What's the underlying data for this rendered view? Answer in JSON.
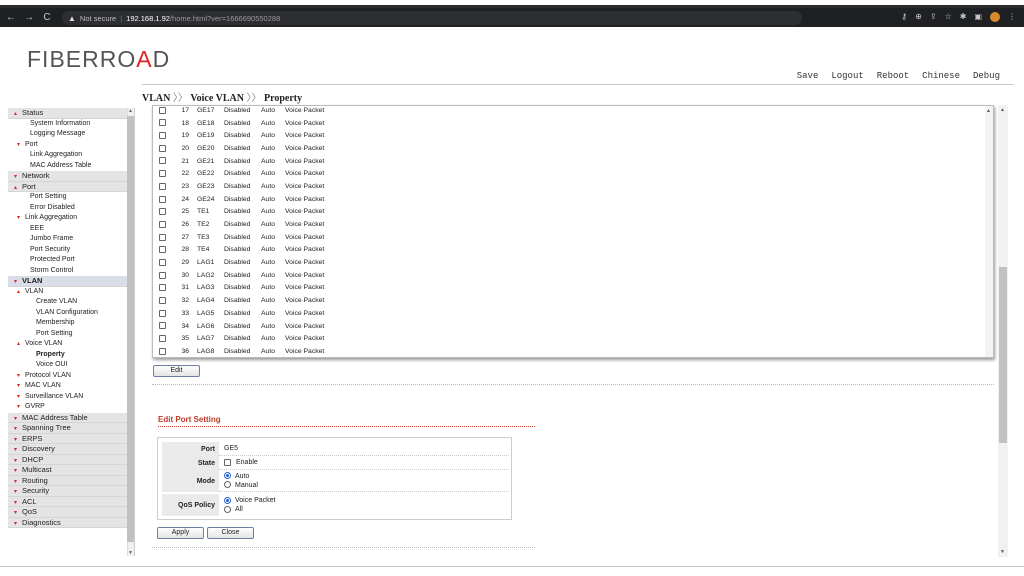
{
  "browser": {
    "security_label": "Not secure",
    "url_host": "192.168.1.92",
    "url_path": "/home.html?ver=1666690550288"
  },
  "header": {
    "logo_main": "FIBERRO",
    "logo_accent": "A",
    "logo_tail": "D",
    "menu": [
      "Save",
      "Logout",
      "Reboot",
      "Chinese",
      "Debug"
    ]
  },
  "breadcrumb": [
    "VLAN",
    "Voice VLAN",
    "Property"
  ],
  "breadcrumb_sep": "〉〉",
  "sidebar": [
    {
      "label": "Status",
      "level": "top",
      "caret": "up"
    },
    {
      "label": "System Information",
      "level": "l2"
    },
    {
      "label": "Logging Message",
      "level": "l2"
    },
    {
      "label": "Port",
      "level": "l2g",
      "caret": "dn"
    },
    {
      "label": "Link Aggregation",
      "level": "l2"
    },
    {
      "label": "MAC Address Table",
      "level": "l2"
    },
    {
      "label": "Network",
      "level": "top",
      "caret": "dn"
    },
    {
      "label": "Port",
      "level": "top",
      "caret": "up"
    },
    {
      "label": "Port Setting",
      "level": "l2"
    },
    {
      "label": "Error Disabled",
      "level": "l2"
    },
    {
      "label": "Link Aggregation",
      "level": "l2g",
      "caret": "dn"
    },
    {
      "label": "EEE",
      "level": "l2"
    },
    {
      "label": "Jumbo Frame",
      "level": "l2"
    },
    {
      "label": "Port Security",
      "level": "l2"
    },
    {
      "label": "Protected Port",
      "level": "l2"
    },
    {
      "label": "Storm Control",
      "level": "l2"
    },
    {
      "label": "VLAN",
      "level": "top-vlan",
      "caret": "dn"
    },
    {
      "label": "VLAN",
      "level": "l2g",
      "caret": "up"
    },
    {
      "label": "Create VLAN",
      "level": "l3"
    },
    {
      "label": "VLAN Configuration",
      "level": "l3"
    },
    {
      "label": "Membership",
      "level": "l3"
    },
    {
      "label": "Port Setting",
      "level": "l3"
    },
    {
      "label": "Voice VLAN",
      "level": "l2g",
      "caret": "up"
    },
    {
      "label": "Property",
      "level": "l3",
      "active": true
    },
    {
      "label": "Voice OUI",
      "level": "l3"
    },
    {
      "label": "Protocol VLAN",
      "level": "l2g",
      "caret": "dn"
    },
    {
      "label": "MAC VLAN",
      "level": "l2g",
      "caret": "dn"
    },
    {
      "label": "Surveillance VLAN",
      "level": "l2g",
      "caret": "dn"
    },
    {
      "label": "GVRP",
      "level": "l2g",
      "caret": "dn"
    },
    {
      "label": "MAC Address Table",
      "level": "top",
      "caret": "dn"
    },
    {
      "label": "Spanning Tree",
      "level": "top",
      "caret": "dn"
    },
    {
      "label": "ERPS",
      "level": "top",
      "caret": "dn"
    },
    {
      "label": "Discovery",
      "level": "top",
      "caret": "dn"
    },
    {
      "label": "DHCP",
      "level": "top",
      "caret": "dn"
    },
    {
      "label": "Multicast",
      "level": "top",
      "caret": "dn"
    },
    {
      "label": "Routing",
      "level": "top",
      "caret": "dn"
    },
    {
      "label": "Security",
      "level": "top",
      "caret": "dn"
    },
    {
      "label": "ACL",
      "level": "top",
      "caret": "dn"
    },
    {
      "label": "QoS",
      "level": "top",
      "caret": "dn"
    },
    {
      "label": "Diagnostics",
      "level": "top",
      "caret": "dn"
    }
  ],
  "port_rows": [
    {
      "num": "17",
      "port": "GE17",
      "state": "Disabled",
      "mode": "Auto",
      "qos": "Voice Packet"
    },
    {
      "num": "18",
      "port": "GE18",
      "state": "Disabled",
      "mode": "Auto",
      "qos": "Voice Packet"
    },
    {
      "num": "19",
      "port": "GE19",
      "state": "Disabled",
      "mode": "Auto",
      "qos": "Voice Packet"
    },
    {
      "num": "20",
      "port": "GE20",
      "state": "Disabled",
      "mode": "Auto",
      "qos": "Voice Packet"
    },
    {
      "num": "21",
      "port": "GE21",
      "state": "Disabled",
      "mode": "Auto",
      "qos": "Voice Packet"
    },
    {
      "num": "22",
      "port": "GE22",
      "state": "Disabled",
      "mode": "Auto",
      "qos": "Voice Packet"
    },
    {
      "num": "23",
      "port": "GE23",
      "state": "Disabled",
      "mode": "Auto",
      "qos": "Voice Packet"
    },
    {
      "num": "24",
      "port": "GE24",
      "state": "Disabled",
      "mode": "Auto",
      "qos": "Voice Packet"
    },
    {
      "num": "25",
      "port": "TE1",
      "state": "Disabled",
      "mode": "Auto",
      "qos": "Voice Packet"
    },
    {
      "num": "26",
      "port": "TE2",
      "state": "Disabled",
      "mode": "Auto",
      "qos": "Voice Packet"
    },
    {
      "num": "27",
      "port": "TE3",
      "state": "Disabled",
      "mode": "Auto",
      "qos": "Voice Packet"
    },
    {
      "num": "28",
      "port": "TE4",
      "state": "Disabled",
      "mode": "Auto",
      "qos": "Voice Packet"
    },
    {
      "num": "29",
      "port": "LAG1",
      "state": "Disabled",
      "mode": "Auto",
      "qos": "Voice Packet"
    },
    {
      "num": "30",
      "port": "LAG2",
      "state": "Disabled",
      "mode": "Auto",
      "qos": "Voice Packet"
    },
    {
      "num": "31",
      "port": "LAG3",
      "state": "Disabled",
      "mode": "Auto",
      "qos": "Voice Packet"
    },
    {
      "num": "32",
      "port": "LAG4",
      "state": "Disabled",
      "mode": "Auto",
      "qos": "Voice Packet"
    },
    {
      "num": "33",
      "port": "LAG5",
      "state": "Disabled",
      "mode": "Auto",
      "qos": "Voice Packet"
    },
    {
      "num": "34",
      "port": "LAG6",
      "state": "Disabled",
      "mode": "Auto",
      "qos": "Voice Packet"
    },
    {
      "num": "35",
      "port": "LAG7",
      "state": "Disabled",
      "mode": "Auto",
      "qos": "Voice Packet"
    },
    {
      "num": "36",
      "port": "LAG8",
      "state": "Disabled",
      "mode": "Auto",
      "qos": "Voice Packet"
    }
  ],
  "edit_button": "Edit",
  "edit_section": {
    "title": "Edit Port Setting",
    "port_label": "Port",
    "port_value": "GE5",
    "state_label": "State",
    "state_option": "Enable",
    "mode_label": "Mode",
    "mode_options": [
      "Auto",
      "Manual"
    ],
    "mode_selected": "Auto",
    "qos_label": "QoS Policy",
    "qos_options": [
      "Voice Packet",
      "All"
    ],
    "qos_selected": "Voice Packet",
    "apply_button": "Apply",
    "close_button": "Close"
  }
}
